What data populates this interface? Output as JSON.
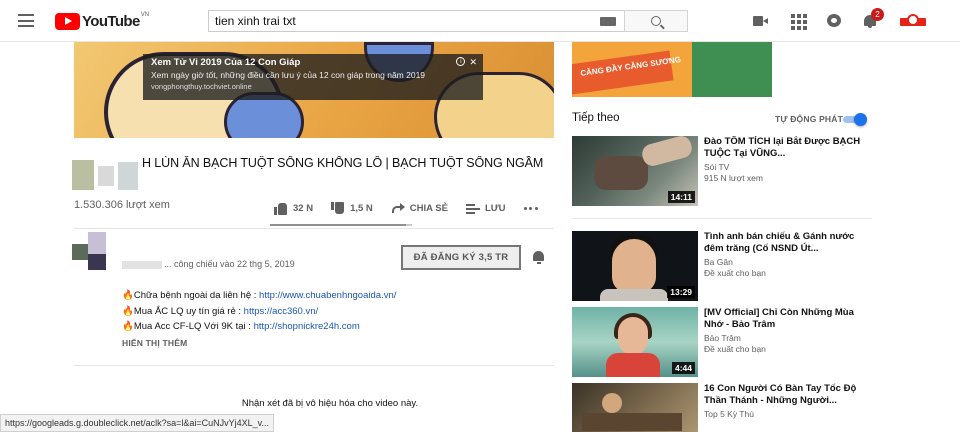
{
  "masthead": {
    "logo_text": "YouTube",
    "country_code": "VN",
    "search_value": "tien xinh trai txt",
    "notification_count": "2",
    "icons": [
      "menu-icon",
      "keyboard-icon",
      "search-icon",
      "create-video-icon",
      "apps-grid-icon",
      "messages-icon",
      "notifications-bell-icon",
      "account-avatar"
    ]
  },
  "video": {
    "overlay_ad": {
      "title": "Xem Tử Vi 2019 Của 12 Con Giáp",
      "description": "Xem ngày giờ tốt, những điều cần lưu ý của 12 con giáp trong năm 2019",
      "url": "vongphongthuy.tochviet.online",
      "close_label": "✕",
      "info_label": "i"
    },
    "title": "H LÙN ĂN BẠCH TUỘT SỐNG KHỔNG LỒ | BẠCH TUỘT SỐNG NGẦM",
    "views": "1.530.306 lượt xem",
    "likes": "32 N",
    "dislikes": "1,5 N",
    "share_label": "CHIA SẺ",
    "save_label": "LƯU",
    "like_ratio": 0.955
  },
  "channel": {
    "published": "... công chiếu vào 22 thg 5, 2019",
    "subscribe_label": "ĐÃ ĐĂNG KÝ  3,5 TR"
  },
  "description": {
    "lines": [
      {
        "icon": "🔥",
        "text": "Chữa bệnh ngoài da liên hệ : ",
        "link": "http://www.chuabenhngoaida.vn/"
      },
      {
        "icon": "🔥",
        "text": "Mua ẮC LQ uy tín giá rẻ : ",
        "link": "https://acc360.vn/"
      },
      {
        "icon": "🔥",
        "text": "Mua Acc CF-LQ Với 9K tại : ",
        "link": "http://shopnickre24h.com"
      }
    ],
    "show_more": "HIỂN THỊ THÊM"
  },
  "comments": {
    "disabled_text": "Nhận xét đã bị vô hiệu hóa cho video này."
  },
  "status_bar_url": "https://googleads.g.doubleclick.net/aclk?sa=l&ai=CuNJvYj4XL_v...",
  "sidebar": {
    "top_ad_label": "CĂNG ĐẦY CĂNG SƯƠNG",
    "up_next": "Tiếp theo",
    "autoplay_label": "TỰ ĐỘNG PHÁT",
    "autoplay_on": true,
    "recommendations": [
      {
        "title": "Đào TÔM TÍCH lại Bắt Được BẠCH TUỘC Tại VŨNG...",
        "channel": "Sói TV",
        "info": "915 N lượt xem",
        "duration": "14:11"
      },
      {
        "title": "Tình anh bán chiếu & Gánh nước đêm trăng (Cố NSND Út...",
        "channel": "Ba Gân",
        "info": "Đề xuất cho bạn",
        "duration": "13:29"
      },
      {
        "title": "[MV Official] Chỉ Còn Những Mùa Nhớ - Bảo Trâm",
        "channel": "Bảo Trâm",
        "info": "Đề xuất cho bạn",
        "duration": "4:44"
      },
      {
        "title": "16 Con Người Có Bàn Tay Tốc Độ Thần Thánh - Những Người...",
        "channel": "Top 5 Kỳ Thú",
        "info": "",
        "duration": ""
      }
    ]
  }
}
